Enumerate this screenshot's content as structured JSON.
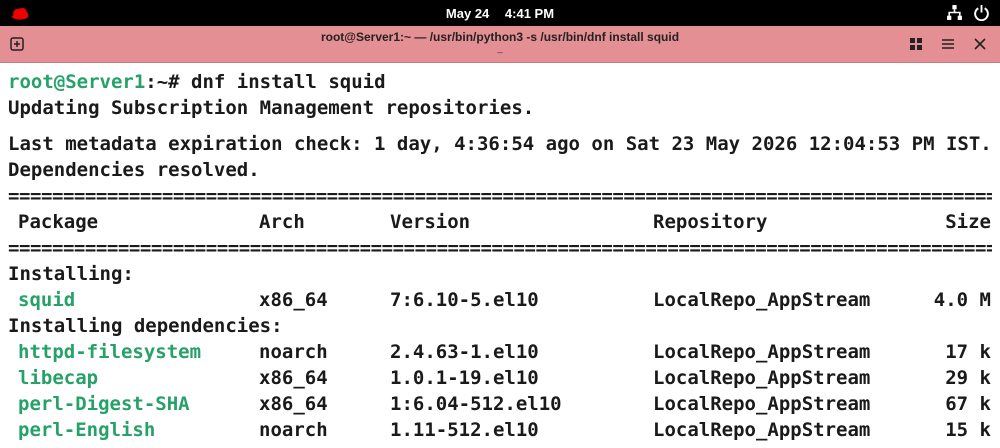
{
  "topbar": {
    "date": "May 24",
    "time": "4:41 PM"
  },
  "titlebar": {
    "title": "root@Server1:~ — /usr/bin/python3 -s /usr/bin/dnf install squid",
    "subtitle": "_"
  },
  "terminal": {
    "prompt_user": "root@Server1",
    "prompt_rest": ":~# ",
    "command": "dnf install squid",
    "line_updating": "Updating Subscription Management repositories.",
    "line_metadata": "Last metadata expiration check: 1 day, 4:36:54 ago on Sat 23 May 2026 12:04:53 PM IST.",
    "line_deps": "Dependencies resolved.",
    "rule": "================================================================================================================",
    "headers": [
      "Package",
      "Arch",
      "Version",
      "Repository",
      "Size"
    ],
    "section_installing": "Installing:",
    "installing": [
      {
        "package": "squid",
        "arch": "x86_64",
        "version": "7:6.10-5.el10",
        "repo": "LocalRepo_AppStream",
        "size": "4.0 M"
      }
    ],
    "section_deps": "Installing dependencies:",
    "dependencies": [
      {
        "package": "httpd-filesystem",
        "arch": "noarch",
        "version": "2.4.63-1.el10",
        "repo": "LocalRepo_AppStream",
        "size": "17 k"
      },
      {
        "package": "libecap",
        "arch": "x86_64",
        "version": "1.0.1-19.el10",
        "repo": "LocalRepo_AppStream",
        "size": "29 k"
      },
      {
        "package": "perl-Digest-SHA",
        "arch": "x86_64",
        "version": "1:6.04-512.el10",
        "repo": "LocalRepo_AppStream",
        "size": "67 k"
      },
      {
        "package": "perl-English",
        "arch": "noarch",
        "version": "1.11-512.el10",
        "repo": "LocalRepo_AppStream",
        "size": "15 k"
      }
    ]
  },
  "icons": {
    "logo": "redhat-logo-icon",
    "network": "network-icon",
    "power": "power-icon",
    "new_tab": "new-tab-icon",
    "grid": "grid-view-icon",
    "menu": "hamburger-menu-icon",
    "close": "close-icon"
  },
  "colors": {
    "titlebar_bg": "#e48f93",
    "prompt_green": "#26a269",
    "text": "#1a1a1a"
  }
}
